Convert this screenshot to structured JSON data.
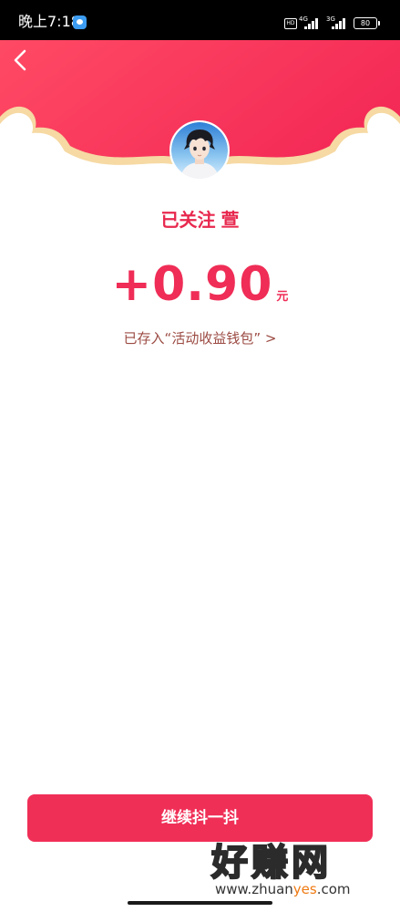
{
  "status_bar": {
    "time": "晚上7:18",
    "hd": "HD",
    "network_1": "4G",
    "network_2": "3G",
    "battery": "80"
  },
  "header": {
    "back_icon": "chevron-left-icon",
    "gradient_start": "#ff4663",
    "gradient_end": "#f42b57",
    "trim_color": "#f6d9a3"
  },
  "result": {
    "follow_status": "已关注",
    "username": "萱",
    "amount": "+0.90",
    "currency": "元",
    "wallet_link": "已存入“活动收益钱包” >",
    "accent_color": "#ef2d56"
  },
  "actions": {
    "continue_label": "继续抖一抖"
  },
  "watermark": {
    "logo_text": "好赚网",
    "url_prefix": "www.zhuan",
    "url_accent": "yes",
    "url_suffix": ".com"
  }
}
